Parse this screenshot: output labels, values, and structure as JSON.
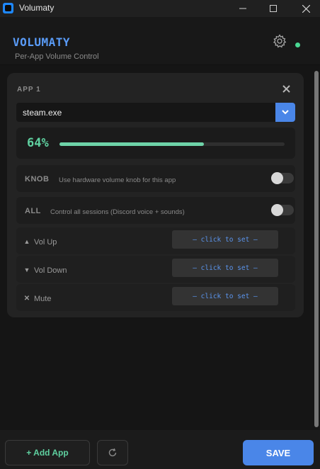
{
  "window": {
    "title": "Volumaty",
    "icons": {
      "app": "app-icon",
      "minimize": "minimize-icon",
      "maximize": "maximize-icon",
      "close": "close-icon"
    }
  },
  "header": {
    "brand": "VOLUMATY",
    "subtitle": "Per-App Volume Control",
    "settings_icon": "gear-icon",
    "status_color": "#4ad893"
  },
  "app_card": {
    "label": "APP 1",
    "selected_app": "steam.exe",
    "volume_percent": 64,
    "volume_label": "64%",
    "knob": {
      "tag": "KNOB",
      "description": "Use hardware volume knob for this app",
      "enabled": false
    },
    "all": {
      "tag": "ALL",
      "description": "Control all sessions (Discord voice + sounds)",
      "enabled": false
    },
    "hotkeys": [
      {
        "icon": "triangle-up-icon",
        "glyph": "▲",
        "label": "Vol Up",
        "value": "— click to set —"
      },
      {
        "icon": "triangle-down-icon",
        "glyph": "▼",
        "label": "Vol Down",
        "value": "— click to set —"
      },
      {
        "icon": "mute-x-icon",
        "glyph": "✕",
        "label": "Mute",
        "value": "— click to set —"
      }
    ]
  },
  "footer": {
    "add_label": "+  Add App",
    "refresh_icon": "refresh-icon",
    "save_label": "SAVE"
  },
  "colors": {
    "accent_blue": "#4a86e8",
    "accent_green": "#5fd0a0",
    "background": "#151515"
  }
}
